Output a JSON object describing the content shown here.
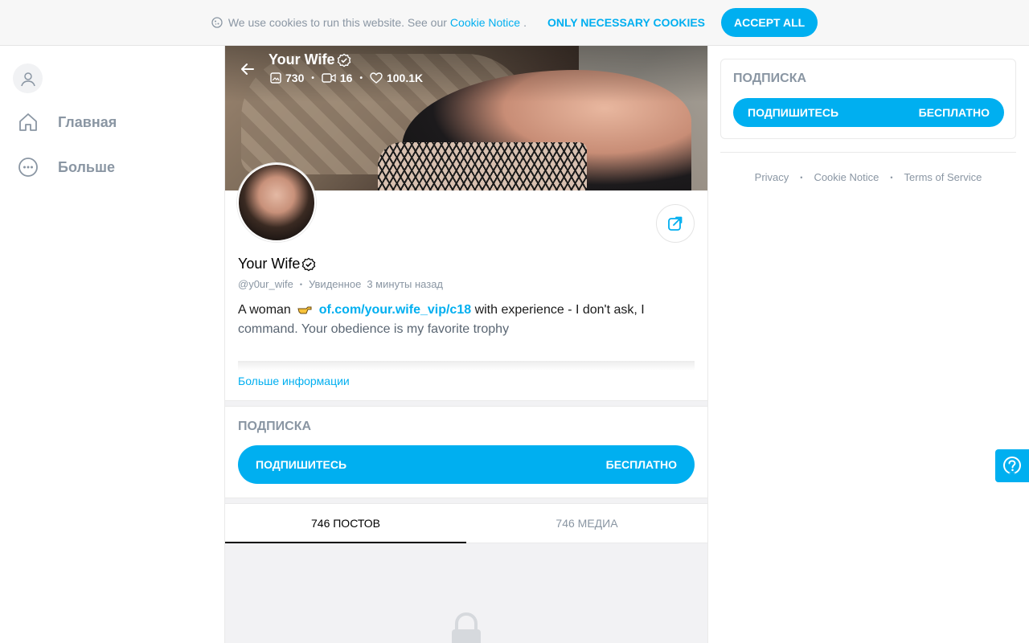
{
  "cookie_bar": {
    "text": "We use cookies to run this website. See our",
    "link": "Cookie Notice",
    "dot": ".",
    "necessary_label": "ONLY NECESSARY COOKIES",
    "accept_label": "ACCEPT ALL"
  },
  "sidebar": {
    "items": [
      {
        "label": "Главная",
        "icon": "home-icon"
      },
      {
        "label": "Больше",
        "icon": "more-icon"
      }
    ]
  },
  "profile": {
    "cover_name": "Your Wife",
    "stats": {
      "photos": "730",
      "videos": "16",
      "likes": "100.1K"
    },
    "name": "Your Wife",
    "handle": "@y0ur_wife",
    "seen_label": "Увиденное",
    "seen_time": "3 минуты назад",
    "bio_intro": "A woman",
    "bio_link": "of.com/your.wife_vip/c18",
    "bio_line1_rest": " with experience - I don't ask, I",
    "bio_line2": "command. Your obedience is my favorite trophy",
    "more_info": "Больше информации"
  },
  "subscription": {
    "title": "ПОДПИСКА",
    "button_label": "ПОДПИШИТЕСЬ",
    "price_label": "БЕСПЛАТНО"
  },
  "tabs": [
    {
      "label": "746 ПОСТОВ",
      "active": true
    },
    {
      "label": "746 МЕДИА",
      "active": false
    }
  ],
  "right_panel": {
    "title": "ПОДПИСКА",
    "button_label": "ПОДПИШИТЕСЬ",
    "price_label": "БЕСПЛАТНО"
  },
  "footer": {
    "privacy": "Privacy",
    "cookie": "Cookie Notice",
    "terms": "Terms of Service"
  },
  "colors": {
    "accent": "#00aff0",
    "muted": "#8a96a3"
  }
}
